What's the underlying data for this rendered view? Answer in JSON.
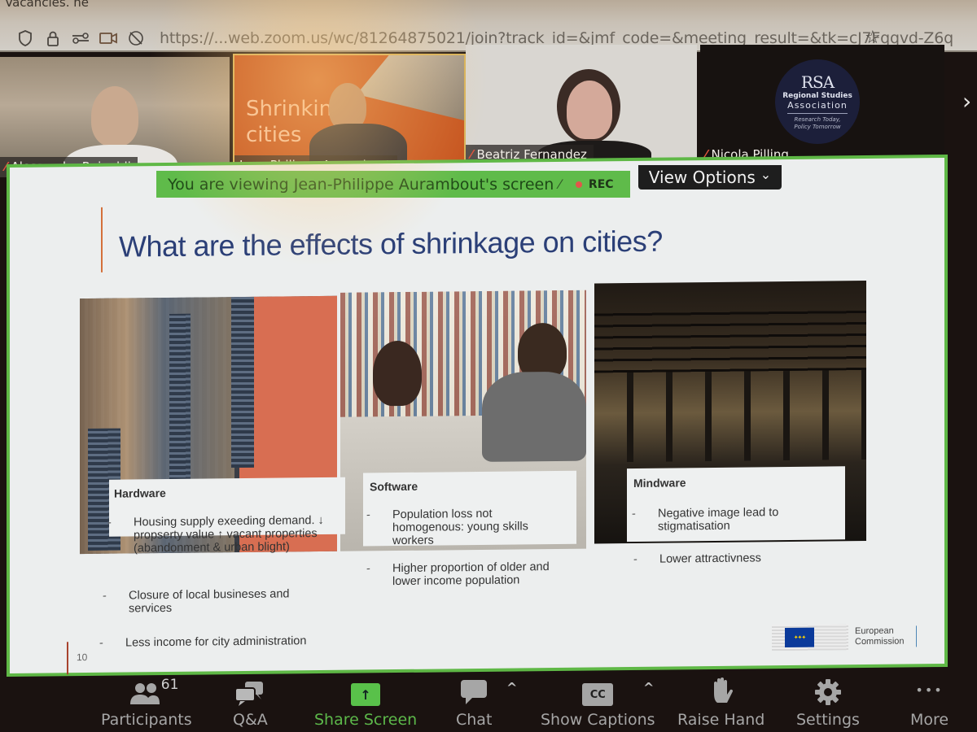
{
  "browser": {
    "tab_text": "Vacancies. ne",
    "url": "https://...web.zoom.us/wc/81264875021/join?track_id=&jmf_code=&meeting_result=&tk=cJ7Fqqvd-Z6q",
    "icons": [
      "shield-icon",
      "lock-icon",
      "permissions-icon",
      "camera-icon",
      "location-blocked-icon",
      "bookmark-star-icon"
    ]
  },
  "participants_strip": {
    "tiles": [
      {
        "name": "Alessandro Rainoldi",
        "muted": true
      },
      {
        "name": "Jean-Philippe Aurambout",
        "muted": false,
        "background_text": "Shrinking cities"
      },
      {
        "name": "Beatriz Fernandez",
        "muted": true
      },
      {
        "name": "Nicola Pilling",
        "muted": true
      }
    ],
    "rsa_logo": {
      "mark": "RSA",
      "line1": "Regional Studies",
      "line2": "Association",
      "tagline1": "Research Today,",
      "tagline2": "Policy Tomorrow"
    },
    "next_arrow": "›"
  },
  "share_banner": {
    "text": "You are viewing Jean-Philippe Aurambout's screen",
    "rec_label": "REC",
    "view_options_label": "View Options",
    "view_options_caret": "⌄"
  },
  "slide": {
    "title": "What are the effects of shrinkage on cities?",
    "number": "10",
    "columns": [
      {
        "heading": "Hardware",
        "bullets": [
          "Housing supply exeeding demand. ↓ propserty value ↑ vacant properties (abandonment & urban blight)",
          "Closure of local busineses and services",
          "Less income for city administration"
        ]
      },
      {
        "heading": "Software",
        "bullets": [
          "Population loss not homogenous: young skills workers",
          "Higher proportion of older and lower income population"
        ]
      },
      {
        "heading": "Mindware",
        "bullets": [
          "Negative image lead to stigmatisation",
          "Lower attractivness"
        ]
      }
    ],
    "logo": {
      "line1": "European",
      "line2": "Commission",
      "flag_stars": "✦✦✦"
    }
  },
  "toolbar": {
    "participants_count": "61",
    "items": [
      {
        "label": "Participants",
        "icon": "participants-icon"
      },
      {
        "label": "Q&A",
        "icon": "qa-icon"
      },
      {
        "label": "Share Screen",
        "icon": "share-screen-icon",
        "glyph": "↑"
      },
      {
        "label": "Chat",
        "icon": "chat-icon"
      },
      {
        "label": "Show Captions",
        "icon": "captions-icon",
        "glyph": "CC"
      },
      {
        "label": "Raise Hand",
        "icon": "raise-hand-icon"
      },
      {
        "label": "Settings",
        "icon": "gear-icon"
      },
      {
        "label": "More",
        "icon": "more-icon",
        "glyph": "•••"
      }
    ],
    "caret": "^"
  },
  "colors": {
    "zoom_green": "#5fbb4a",
    "slide_title_blue": "#2b3f77",
    "mute_red": "#e0563e",
    "toolbar_text": "#a6a6a6"
  }
}
